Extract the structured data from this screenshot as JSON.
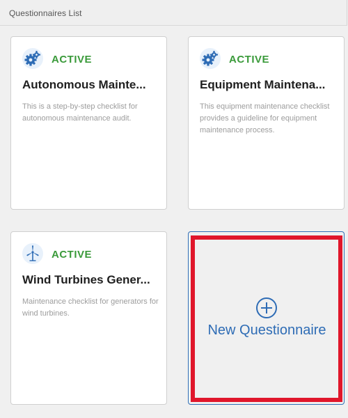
{
  "header": {
    "title": "Questionnaires List"
  },
  "cards": [
    {
      "icon": "gears-icon",
      "status": "ACTIVE",
      "title": "Autonomous Mainte...",
      "description": "This is a step-by-step checklist for autonomous maintenance audit."
    },
    {
      "icon": "gears-icon",
      "status": "ACTIVE",
      "title": "Equipment Maintena...",
      "description": "This equipment maintenance checklist provides a guideline for equipment maintenance process."
    },
    {
      "icon": "wind-turbine-icon",
      "status": "ACTIVE",
      "title": "Wind Turbines Gener...",
      "description": "Maintenance checklist for generators for wind turbines."
    }
  ],
  "new_questionnaire": {
    "label": "New Questionnaire",
    "icon": "plus-circle-icon"
  },
  "colors": {
    "status_active": "#3a9a3a",
    "accent": "#2e6cb5",
    "highlight": "#e0162b"
  }
}
